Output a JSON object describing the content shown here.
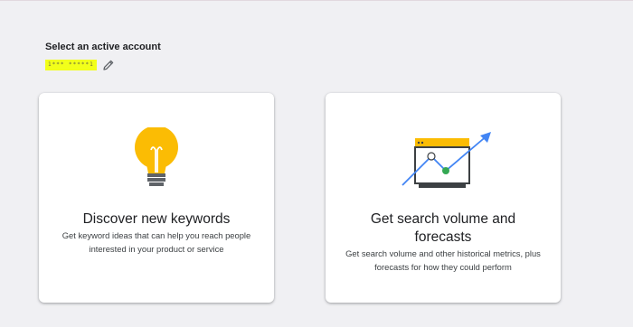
{
  "account": {
    "heading": "Select an active account",
    "account_id": "1*** *****1"
  },
  "cards": [
    {
      "icon": "lightbulb-icon",
      "title": "Discover new keywords",
      "description": "Get keyword ideas that can help you reach people interested in your product or service"
    },
    {
      "icon": "trend-chart-icon",
      "title": "Get search volume and forecasts",
      "description": "Get search volume and other historical metrics, plus forecasts for how they could perform"
    }
  ],
  "colors": {
    "page_background": "#f0f0f3",
    "highlight": "#f2ff1a",
    "bulb_yellow": "#fbbc04",
    "trend_blue": "#4285f4",
    "trend_green": "#34a853"
  }
}
